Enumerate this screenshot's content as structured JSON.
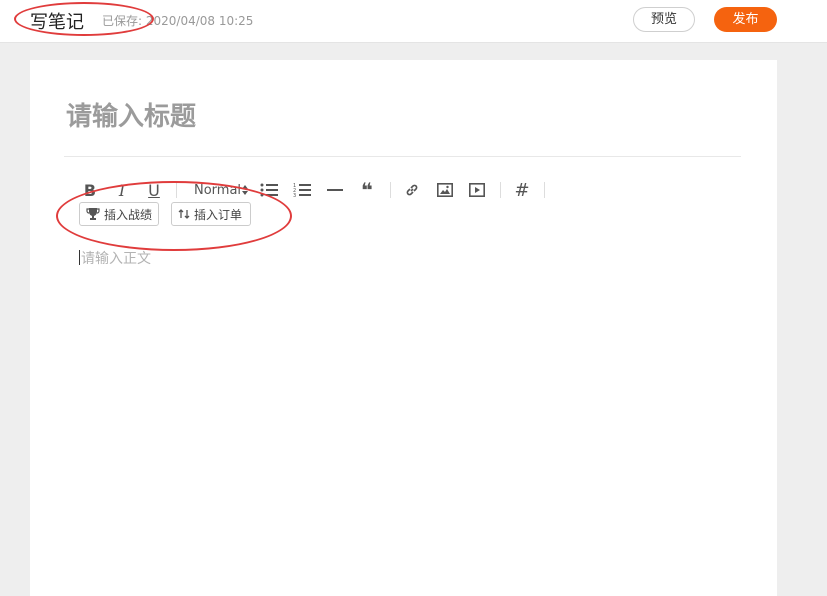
{
  "header": {
    "title": "写笔记",
    "saved_text": "已保存: 2020/04/08 10:25",
    "preview_label": "预览",
    "publish_label": "发布",
    "publish_color": "#f5630f"
  },
  "editor": {
    "title_placeholder": "请输入标题",
    "body_placeholder": "请输入正文",
    "toolbar": {
      "bold": "B",
      "italic": "I",
      "underline": "U",
      "heading_select": "Normal",
      "quote": "❝",
      "tag": "#"
    },
    "insert_buttons": {
      "achievement": "插入战绩",
      "order": "插入订单"
    }
  },
  "annotation_color": "#e03c3c"
}
